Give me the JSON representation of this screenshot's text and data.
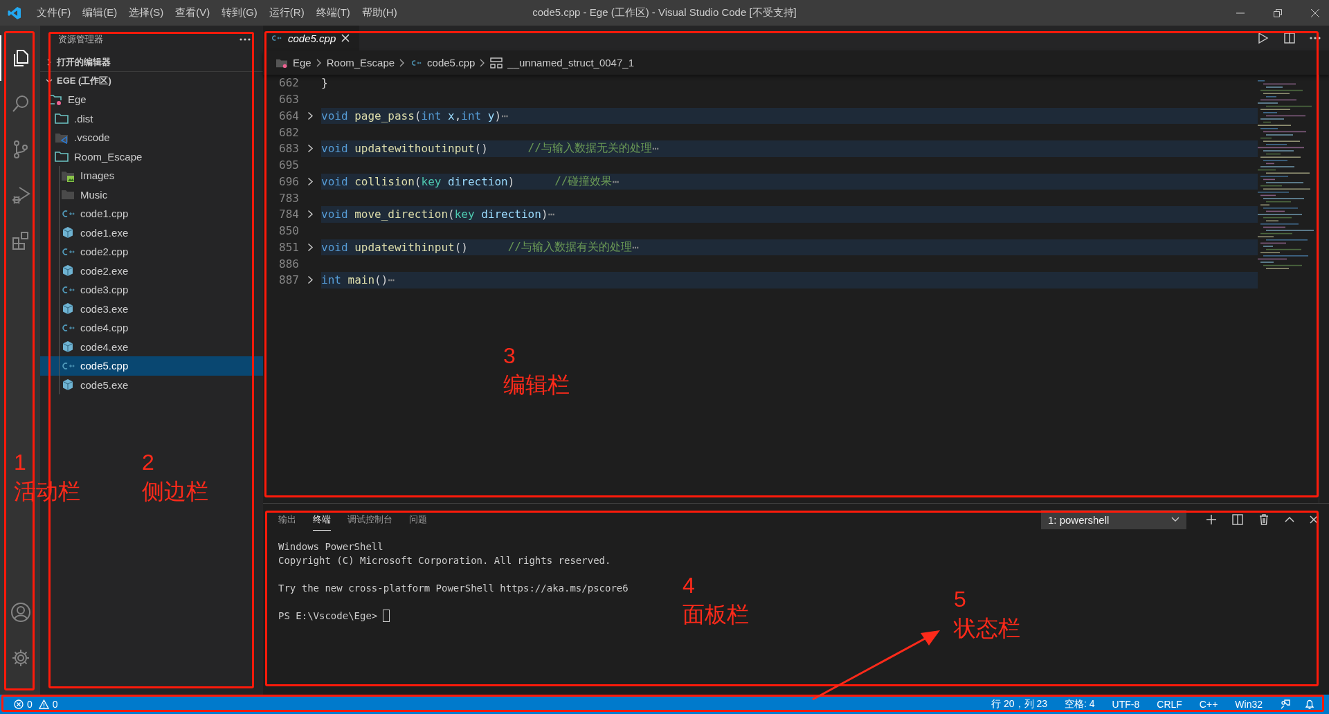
{
  "title_bar": {
    "menu": [
      "文件(F)",
      "编辑(E)",
      "选择(S)",
      "查看(V)",
      "转到(G)",
      "运行(R)",
      "终端(T)",
      "帮助(H)"
    ],
    "title": "code5.cpp - Ege (工作区) - Visual Studio Code [不受支持]"
  },
  "activity_bar": {
    "items": [
      {
        "kind": "explorer",
        "selected": true
      },
      {
        "kind": "search",
        "selected": false
      },
      {
        "kind": "source-control",
        "selected": false
      },
      {
        "kind": "run",
        "selected": false
      },
      {
        "kind": "extensions",
        "selected": false
      }
    ],
    "bottom": [
      {
        "kind": "account"
      },
      {
        "kind": "settings"
      }
    ]
  },
  "sidebar": {
    "title": "资源管理器",
    "open_editors": {
      "label": "打开的编辑器",
      "expanded": false
    },
    "workspace": {
      "label": "EGE (工作区)",
      "expanded": true,
      "children": [
        {
          "name": "Ege",
          "kind": "root-folder",
          "selected": false,
          "children": [
            {
              "name": ".dist",
              "kind": "folder",
              "selected": false
            },
            {
              "name": ".vscode",
              "kind": "vscode-folder",
              "selected": false
            },
            {
              "name": "Room_Escape",
              "kind": "folder",
              "selected": false,
              "children": [
                {
                  "name": "Images",
                  "kind": "image-folder",
                  "selected": false
                },
                {
                  "name": "Music",
                  "kind": "grey-folder",
                  "selected": false
                },
                {
                  "name": "code1.cpp",
                  "kind": "cpp",
                  "selected": false
                },
                {
                  "name": "code1.exe",
                  "kind": "exe",
                  "selected": false
                },
                {
                  "name": "code2.cpp",
                  "kind": "cpp",
                  "selected": false
                },
                {
                  "name": "code2.exe",
                  "kind": "exe",
                  "selected": false
                },
                {
                  "name": "code3.cpp",
                  "kind": "cpp",
                  "selected": false
                },
                {
                  "name": "code3.exe",
                  "kind": "exe",
                  "selected": false
                },
                {
                  "name": "code4.cpp",
                  "kind": "cpp",
                  "selected": false
                },
                {
                  "name": "code4.exe",
                  "kind": "exe",
                  "selected": false
                },
                {
                  "name": "code5.cpp",
                  "kind": "cpp",
                  "selected": true
                },
                {
                  "name": "code5.exe",
                  "kind": "exe",
                  "selected": false
                }
              ]
            }
          ]
        }
      ]
    }
  },
  "editor": {
    "tabs": [
      {
        "label": "code5.cpp",
        "selected": true
      }
    ],
    "breadcrumbs": [
      {
        "label": "Ege",
        "kind": "root-folder"
      },
      {
        "label": "Room_Escape",
        "kind": "none"
      },
      {
        "label": "code5.cpp",
        "kind": "cpp"
      },
      {
        "label": "__unnamed_struct_0047_1",
        "kind": "struct"
      }
    ],
    "lines": [
      {
        "number": "662",
        "folded": false,
        "tokens": [
          {
            "kind": "plain",
            "text": "}"
          }
        ]
      },
      {
        "number": "663",
        "folded": false
      },
      {
        "number": "664",
        "folded": true,
        "tokens": [
          {
            "kind": "keyword",
            "text": "void"
          },
          {
            "kind": "function",
            "text": "page_pass"
          },
          {
            "kind": "plain",
            "text": "("
          },
          {
            "kind": "keyword",
            "text": "int"
          },
          {
            "kind": "param",
            "text": "x"
          },
          {
            "kind": "plain",
            "text": ","
          },
          {
            "kind": "keyword",
            "text": "int"
          },
          {
            "kind": "param",
            "text": "y"
          },
          {
            "kind": "plain",
            "text": ")"
          },
          {
            "kind": "ellipsis",
            "text": "⋯"
          }
        ]
      },
      {
        "number": "682",
        "folded": false
      },
      {
        "number": "683",
        "folded": true,
        "tokens": [
          {
            "kind": "keyword",
            "text": "void"
          },
          {
            "kind": "function",
            "text": "updatewithoutinput"
          },
          {
            "kind": "plain",
            "text": "()"
          },
          {
            "kind": "comment",
            "text": "//与输入数据无关的处理"
          },
          {
            "kind": "ellipsis",
            "text": "⋯"
          }
        ]
      },
      {
        "number": "695",
        "folded": false
      },
      {
        "number": "696",
        "folded": true,
        "tokens": [
          {
            "kind": "keyword",
            "text": "void"
          },
          {
            "kind": "function",
            "text": "collision"
          },
          {
            "kind": "plain",
            "text": "("
          },
          {
            "kind": "type",
            "text": "key"
          },
          {
            "kind": "param",
            "text": "direction"
          },
          {
            "kind": "plain",
            "text": ")"
          },
          {
            "kind": "comment",
            "text": "//碰撞效果"
          },
          {
            "kind": "ellipsis",
            "text": "⋯"
          }
        ]
      },
      {
        "number": "783",
        "folded": false
      },
      {
        "number": "784",
        "folded": true,
        "tokens": [
          {
            "kind": "keyword",
            "text": "void"
          },
          {
            "kind": "function",
            "text": "move_direction"
          },
          {
            "kind": "plain",
            "text": "("
          },
          {
            "kind": "type",
            "text": "key"
          },
          {
            "kind": "param",
            "text": "direction"
          },
          {
            "kind": "plain",
            "text": ")"
          },
          {
            "kind": "ellipsis",
            "text": "⋯"
          }
        ]
      },
      {
        "number": "850",
        "folded": false
      },
      {
        "number": "851",
        "folded": true,
        "tokens": [
          {
            "kind": "keyword",
            "text": "void"
          },
          {
            "kind": "function",
            "text": "updatewithinput"
          },
          {
            "kind": "plain",
            "text": "()"
          },
          {
            "kind": "comment",
            "text": "//与输入数据有关的处理"
          },
          {
            "kind": "ellipsis",
            "text": "⋯"
          }
        ]
      },
      {
        "number": "886",
        "folded": false
      },
      {
        "number": "887",
        "folded": true,
        "tokens": [
          {
            "kind": "keyword",
            "text": "int"
          },
          {
            "kind": "function",
            "text": "main"
          },
          {
            "kind": "plain",
            "text": "()"
          },
          {
            "kind": "ellipsis",
            "text": "⋯"
          }
        ]
      }
    ]
  },
  "panel": {
    "tabs": [
      {
        "label": "输出",
        "selected": false
      },
      {
        "label": "终端",
        "selected": true
      },
      {
        "label": "调试控制台",
        "selected": false
      },
      {
        "label": "问题",
        "selected": false
      }
    ],
    "terminal_select": "1: powershell",
    "terminal": [
      [
        "Windows PowerShell",
        "Copyright (C) Microsoft Corporation. All rights reserved."
      ],
      [
        "Try the new cross-platform PowerShell https://aka.ms/pscore6"
      ],
      [
        "PS E:\\Vscode\\Ege>"
      ]
    ]
  },
  "status_bar": {
    "errors": "0",
    "warnings": "0",
    "items": [
      "行 20，列 23",
      "空格: 4",
      "UTF-8",
      "CRLF",
      "C++",
      "Win32"
    ]
  },
  "annotations": [
    {
      "number": "1",
      "label": "活动栏"
    },
    {
      "number": "2",
      "label": "侧边栏"
    },
    {
      "number": "3",
      "label": "编辑栏"
    },
    {
      "number": "4",
      "label": "面板栏"
    },
    {
      "number": "5",
      "label": "状态栏"
    }
  ]
}
